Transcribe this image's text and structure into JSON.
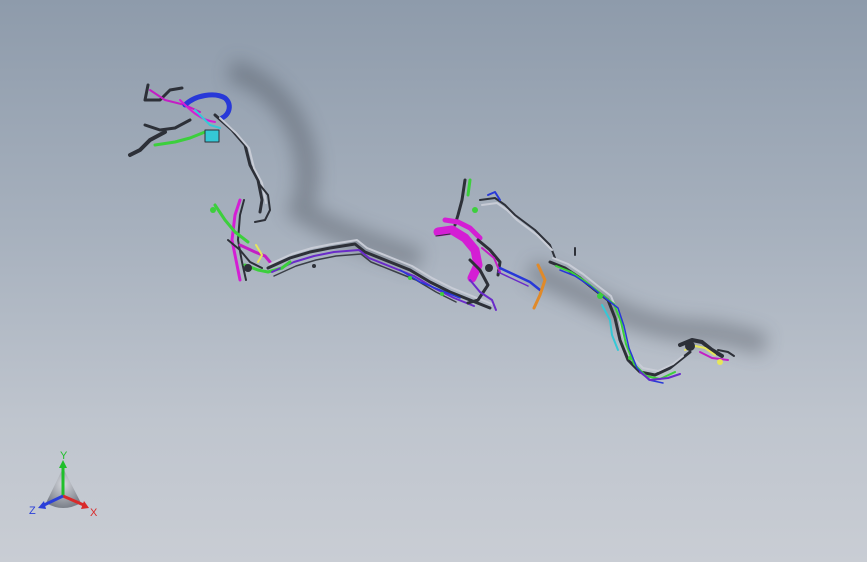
{
  "viewport": {
    "background_top": "#8e9bab",
    "background_bottom": "#c9cdd4"
  },
  "model": {
    "description_colors": {
      "tube_dark": "#3b3f47",
      "tube_light": "#c8ccd6",
      "magenta": "#d41ed4",
      "purple": "#6a2bc9",
      "green": "#3ccf3c",
      "cyan": "#35c8d6",
      "blue": "#2838d8",
      "orange": "#e08a2a",
      "yellow": "#e6e65a"
    }
  },
  "triad": {
    "y_label": "Y",
    "x_label": "X",
    "z_label": "Z",
    "y_color": "#1fbf2a",
    "x_color": "#d92a2a",
    "z_color": "#2a3fd9"
  }
}
